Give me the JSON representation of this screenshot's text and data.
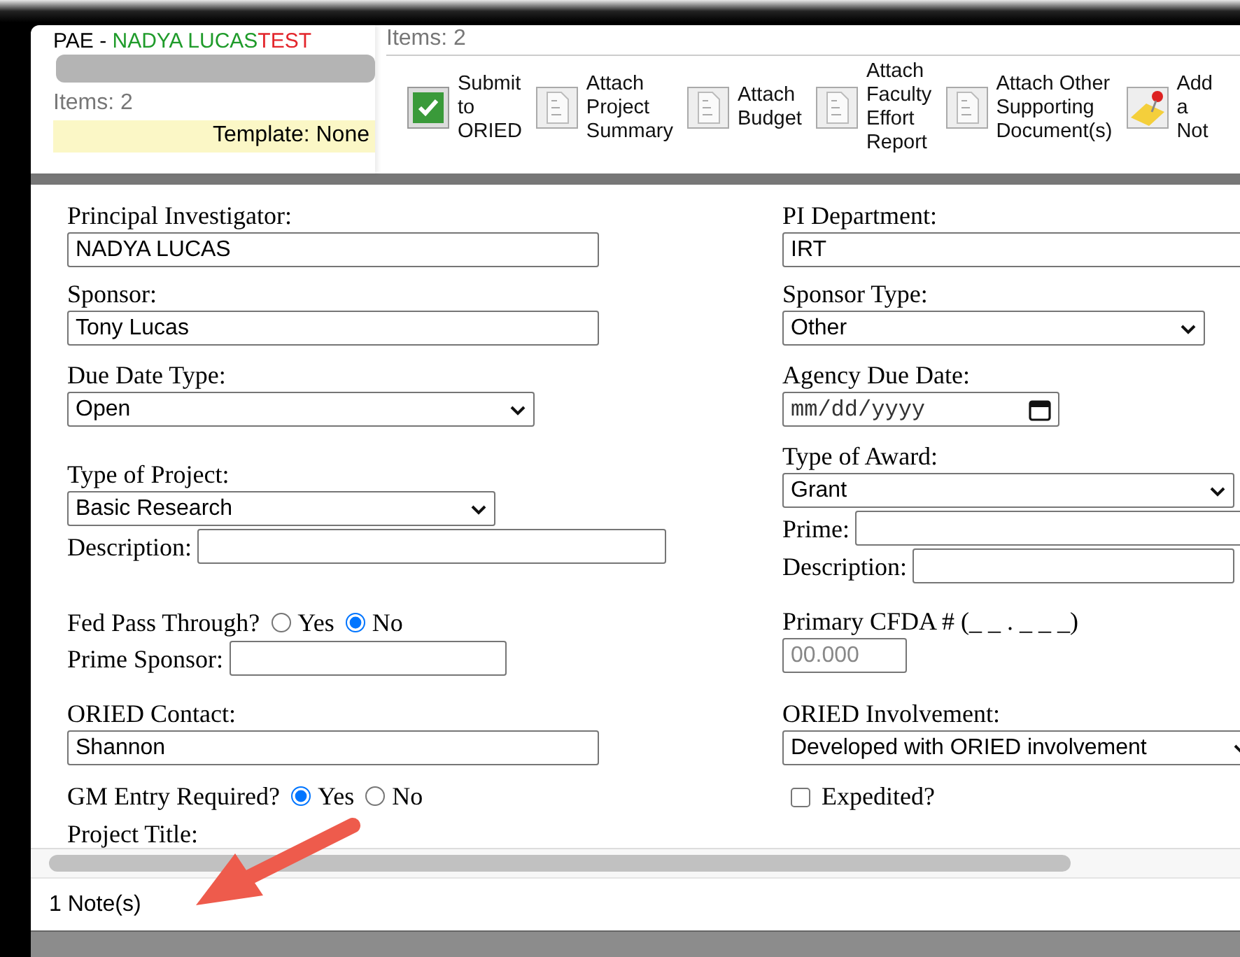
{
  "header": {
    "title": {
      "prefix": "PAE -",
      "name": "NADYA LUCAS",
      "suffix": "TEST"
    },
    "items_left": "Items: 2",
    "template": "Template: None",
    "items_right": "Items: 2"
  },
  "toolbar": [
    {
      "kind": "check",
      "label": "Submit\nto\nORIED"
    },
    {
      "kind": "document",
      "label": "Attach\nProject\nSummary"
    },
    {
      "kind": "document",
      "label": "Attach\nBudget"
    },
    {
      "kind": "document",
      "label": "Attach\nFaculty\nEffort\nReport"
    },
    {
      "kind": "document",
      "label": "Attach Other\nSupporting\nDocument(s)"
    },
    {
      "kind": "note",
      "label": "Add\na\nNot"
    }
  ],
  "form": {
    "rows": [
      {
        "left": [
          {
            "kind": "stacked",
            "label": "Principal Investigator:",
            "field": {
              "kind": "text",
              "value": "NADYA LUCAS"
            }
          }
        ],
        "right": [
          {
            "kind": "stacked",
            "label": "PI Department:",
            "field": {
              "kind": "text",
              "value": "IRT"
            }
          }
        ]
      },
      {
        "left": [
          {
            "kind": "stacked",
            "label": "Sponsor:",
            "field": {
              "kind": "text",
              "value": "Tony Lucas"
            }
          }
        ],
        "right": [
          {
            "kind": "stacked",
            "label": "Sponsor Type:",
            "field": {
              "kind": "select",
              "value": "Other"
            }
          }
        ]
      },
      {
        "left": [
          {
            "kind": "stacked",
            "label": "Due Date Type:",
            "field": {
              "kind": "select",
              "value": "Open"
            }
          }
        ],
        "right": [
          {
            "kind": "stacked",
            "label": "Agency Due Date:",
            "field": {
              "kind": "date",
              "placeholder": "mm/dd/yyyy"
            }
          }
        ]
      },
      {
        "left": [
          {
            "kind": "stacked",
            "label": "Type of Project:",
            "field": {
              "kind": "select",
              "value": "Basic Research"
            }
          },
          {
            "kind": "inline",
            "label": "Description:",
            "field": {
              "kind": "text"
            }
          }
        ],
        "right": [
          {
            "kind": "stacked",
            "label": "Type of Award:",
            "field": {
              "kind": "select",
              "value": "Grant"
            }
          },
          {
            "kind": "inline",
            "label": "Prime:",
            "field": {
              "kind": "text"
            }
          },
          {
            "kind": "inline",
            "label": "Description:",
            "field": {
              "kind": "text"
            }
          }
        ]
      },
      {
        "left": [
          {
            "kind": "radio",
            "label": "Fed Pass Through?",
            "options": [
              {
                "label": "Yes",
                "selected": false
              },
              {
                "label": "No",
                "selected": true
              }
            ]
          },
          {
            "kind": "inline",
            "label": "Prime Sponsor:",
            "field": {
              "kind": "text"
            }
          }
        ],
        "right": [
          {
            "kind": "stacked",
            "label": "Primary CFDA # (_ _ . _ _ _)",
            "field": {
              "kind": "text",
              "placeholder": "00.000"
            }
          }
        ]
      },
      {
        "left": [
          {
            "kind": "stacked",
            "label": "ORIED Contact:",
            "field": {
              "kind": "text",
              "value": "Shannon"
            }
          }
        ],
        "right": [
          {
            "kind": "stacked",
            "label": "ORIED Involvement:",
            "field": {
              "kind": "select",
              "value": "Developed with ORIED involvement"
            }
          }
        ]
      },
      {
        "left": [
          {
            "kind": "radio",
            "label": "GM Entry Required?",
            "options": [
              {
                "label": "Yes",
                "selected": true
              },
              {
                "label": "No",
                "selected": false
              }
            ]
          }
        ],
        "right": [
          {
            "kind": "checkbox",
            "label": "Expedited?",
            "checked": false
          }
        ]
      },
      {
        "left": [
          {
            "kind": "label",
            "label": "Project Title:"
          }
        ],
        "right": []
      }
    ]
  },
  "footer": {
    "notes": "1 Note(s)"
  }
}
